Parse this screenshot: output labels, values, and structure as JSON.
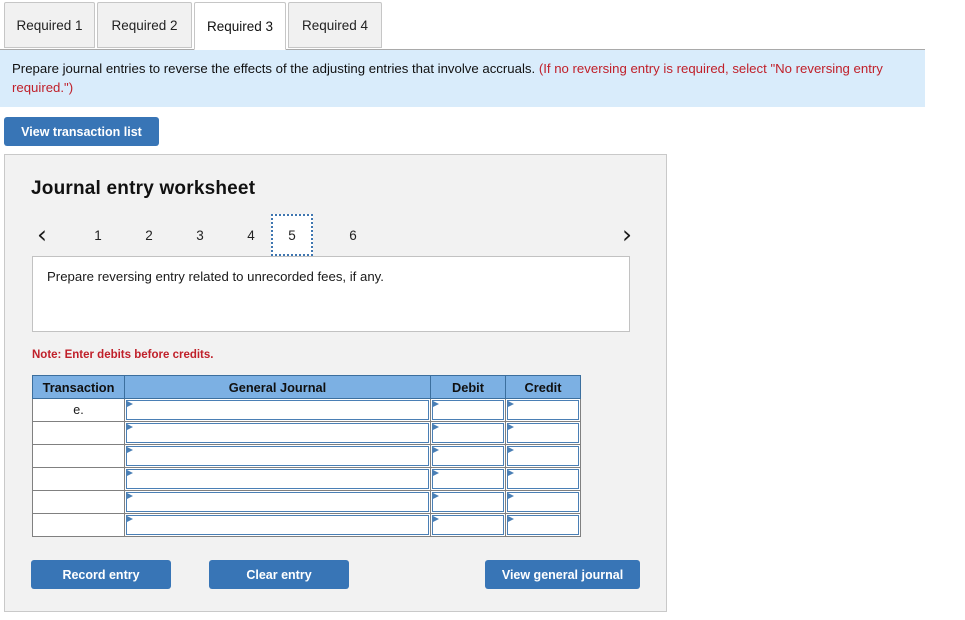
{
  "tabs": [
    {
      "label": "Required 1",
      "active": false
    },
    {
      "label": "Required 2",
      "active": false
    },
    {
      "label": "Required 3",
      "active": true
    },
    {
      "label": "Required 4",
      "active": false
    }
  ],
  "banner": {
    "text_black": "Prepare journal entries to reverse the effects of the adjusting entries that involve accruals.",
    "text_red": "(If no reversing entry is required, select \"No reversing entry required.\")"
  },
  "toolbar": {
    "view_transaction_list_label": "View transaction list"
  },
  "worksheet": {
    "title": "Journal entry worksheet",
    "pager": {
      "prev_icon": "chevron-left-icon",
      "prev_glyph": "‹",
      "next_icon": "chevron-right-icon",
      "next_glyph": "›",
      "pages": [
        "1",
        "2",
        "3",
        "4",
        "5",
        "6"
      ],
      "active_page": "5"
    },
    "prompt": "Prepare reversing entry related to unrecorded fees, if any.",
    "note": "Note: Enter debits before credits.",
    "table": {
      "headers": [
        "Transaction",
        "General Journal",
        "Debit",
        "Credit"
      ],
      "rows": [
        {
          "transaction": "e.",
          "general_journal": "",
          "debit": "",
          "credit": ""
        },
        {
          "transaction": "",
          "general_journal": "",
          "debit": "",
          "credit": ""
        },
        {
          "transaction": "",
          "general_journal": "",
          "debit": "",
          "credit": ""
        },
        {
          "transaction": "",
          "general_journal": "",
          "debit": "",
          "credit": ""
        },
        {
          "transaction": "",
          "general_journal": "",
          "debit": "",
          "credit": ""
        },
        {
          "transaction": "",
          "general_journal": "",
          "debit": "",
          "credit": ""
        }
      ]
    },
    "buttons": {
      "record_entry": "Record entry",
      "clear_entry": "Clear entry",
      "view_general_journal": "View general journal"
    }
  },
  "colors": {
    "accent_blue": "#3875b6",
    "table_header_blue": "#7cb0e3",
    "banner_blue": "#d9ecfb",
    "panel_gray": "#f2f2f2",
    "alert_red": "#c0202a"
  }
}
